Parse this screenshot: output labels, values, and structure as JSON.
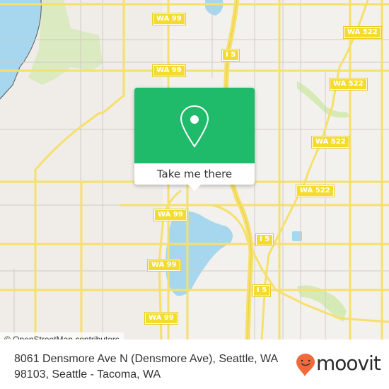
{
  "map": {
    "region": "Seattle, WA",
    "highway_shields": [
      {
        "label": "WA 99"
      },
      {
        "label": "WA 99"
      },
      {
        "label": "WA 99"
      },
      {
        "label": "WA 99"
      },
      {
        "label": "WA 99"
      },
      {
        "label": "WA 522"
      },
      {
        "label": "WA 522"
      },
      {
        "label": "WA 522"
      },
      {
        "label": "WA 522"
      },
      {
        "label": "I 5"
      },
      {
        "label": "I 5"
      },
      {
        "label": "I 5"
      }
    ],
    "colors": {
      "land": "#f0ece8",
      "water": "#a6d7ee",
      "park": "#d6eab6",
      "major_road": "#f6e06c",
      "minor_road": "#c8c2bd"
    }
  },
  "popup": {
    "icon": "location-pin-icon",
    "button_label": "Take me there",
    "color": "#1fba6a"
  },
  "attribution": "© OpenStreetMap contributors",
  "footer": {
    "address": "8061 Densmore Ave N (Densmore Ave), Seattle, WA 98103, Seattle - Tacoma, WA",
    "brand": "moovit",
    "brand_color": "#f26a3b"
  }
}
